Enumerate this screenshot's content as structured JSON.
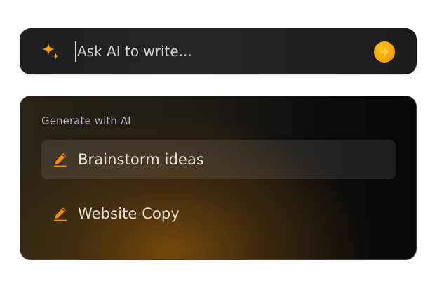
{
  "prompt": {
    "placeholder": "Ask AI to write...",
    "icon": "sparkle-icon",
    "send_icon": "arrow-right-icon",
    "accent": "#FFA500"
  },
  "panel": {
    "heading": "Generate with AI",
    "options": [
      {
        "label": "Brainstorm ideas",
        "icon": "pencil-icon",
        "active": true
      },
      {
        "label": "Website Copy",
        "icon": "pencil-icon",
        "active": false
      }
    ]
  },
  "colors": {
    "bar_bg": "#1E1E1E",
    "panel_bg": "#0E0E0E",
    "accent_orange": "#FF8A00",
    "highlight_glow": "#82500A"
  }
}
